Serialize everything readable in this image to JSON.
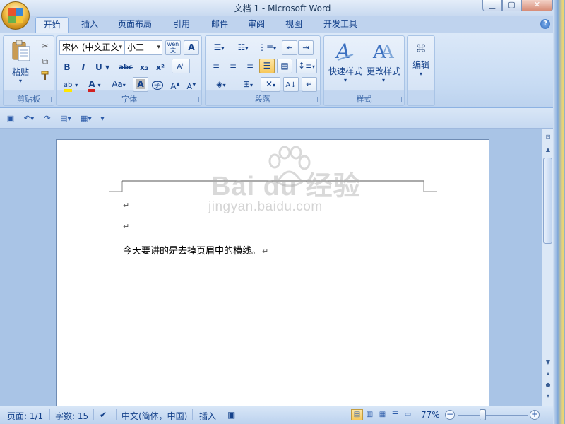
{
  "window": {
    "title": "文档 1 - Microsoft Word",
    "minimize_icon": "minimize-icon",
    "maximize_icon": "maximize-icon",
    "close_icon": "close-icon"
  },
  "tabs": [
    "开始",
    "插入",
    "页面布局",
    "引用",
    "邮件",
    "审阅",
    "视图",
    "开发工具"
  ],
  "active_tab": "开始",
  "ribbon": {
    "clipboard": {
      "label": "剪贴板",
      "paste_label": "粘贴"
    },
    "font": {
      "label": "字体",
      "font_name": "宋体 (中文正文",
      "font_size": "小三",
      "phonetic_label": "wén",
      "char_label": "A"
    },
    "paragraph": {
      "label": "段落"
    },
    "styles": {
      "label": "样式",
      "quick_styles": "快速样式",
      "change_styles": "更改样式"
    },
    "editing": {
      "label": "编辑",
      "editing_label": "编辑"
    }
  },
  "document": {
    "watermark_logo": "Bai  du 经验",
    "watermark_url": "jingyan.baidu.com",
    "paragraph_mark": "↵",
    "body_text": "今天要讲的是去掉页眉中的横线。"
  },
  "statusbar": {
    "page": "页面: 1/1",
    "words": "字数: 15",
    "language": "中文(简体，中国)",
    "mode": "插入",
    "zoom": "77%",
    "zoom_level": 0.77
  },
  "colors": {
    "ribbon_bg": "#c7dbf3",
    "accent_text": "#15428b",
    "highlight_active": "#f7c85b"
  }
}
